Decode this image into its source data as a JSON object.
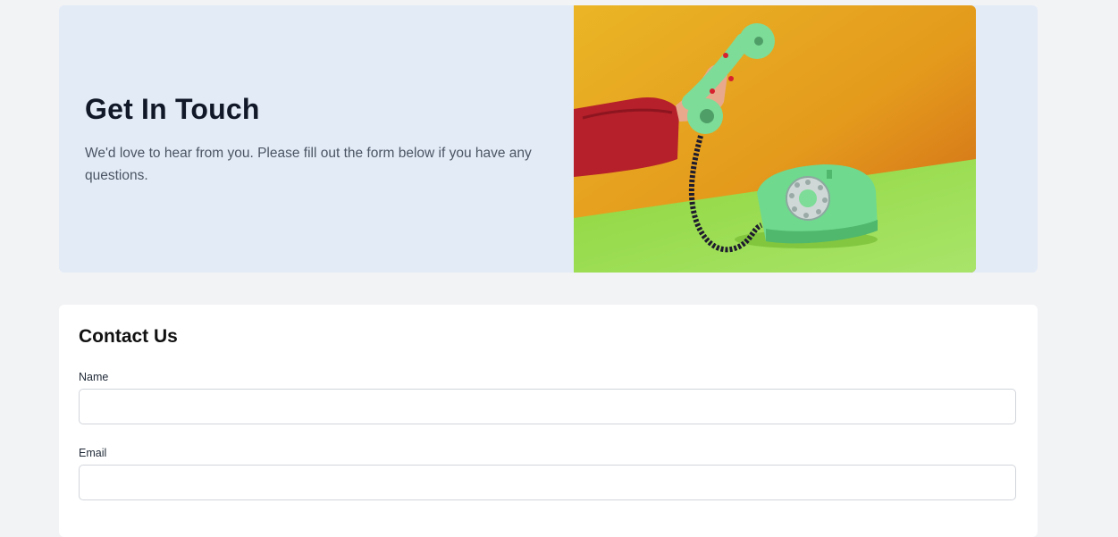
{
  "hero": {
    "title": "Get In Touch",
    "subtitle": "We'd love to hear from you. Please fill out the form below if you have any questions.",
    "image_alt": "Hand holding green rotary telephone receiver"
  },
  "contact_form": {
    "title": "Contact Us",
    "fields": [
      {
        "label": "Name",
        "value": "",
        "placeholder": ""
      },
      {
        "label": "Email",
        "value": "",
        "placeholder": ""
      }
    ]
  },
  "colors": {
    "page_background": "#f2f3f5",
    "hero_background": "#e3ebf7",
    "card_background": "#ffffff",
    "title_text": "#111827",
    "body_text": "#4b5563",
    "input_border": "#d1d5db"
  }
}
